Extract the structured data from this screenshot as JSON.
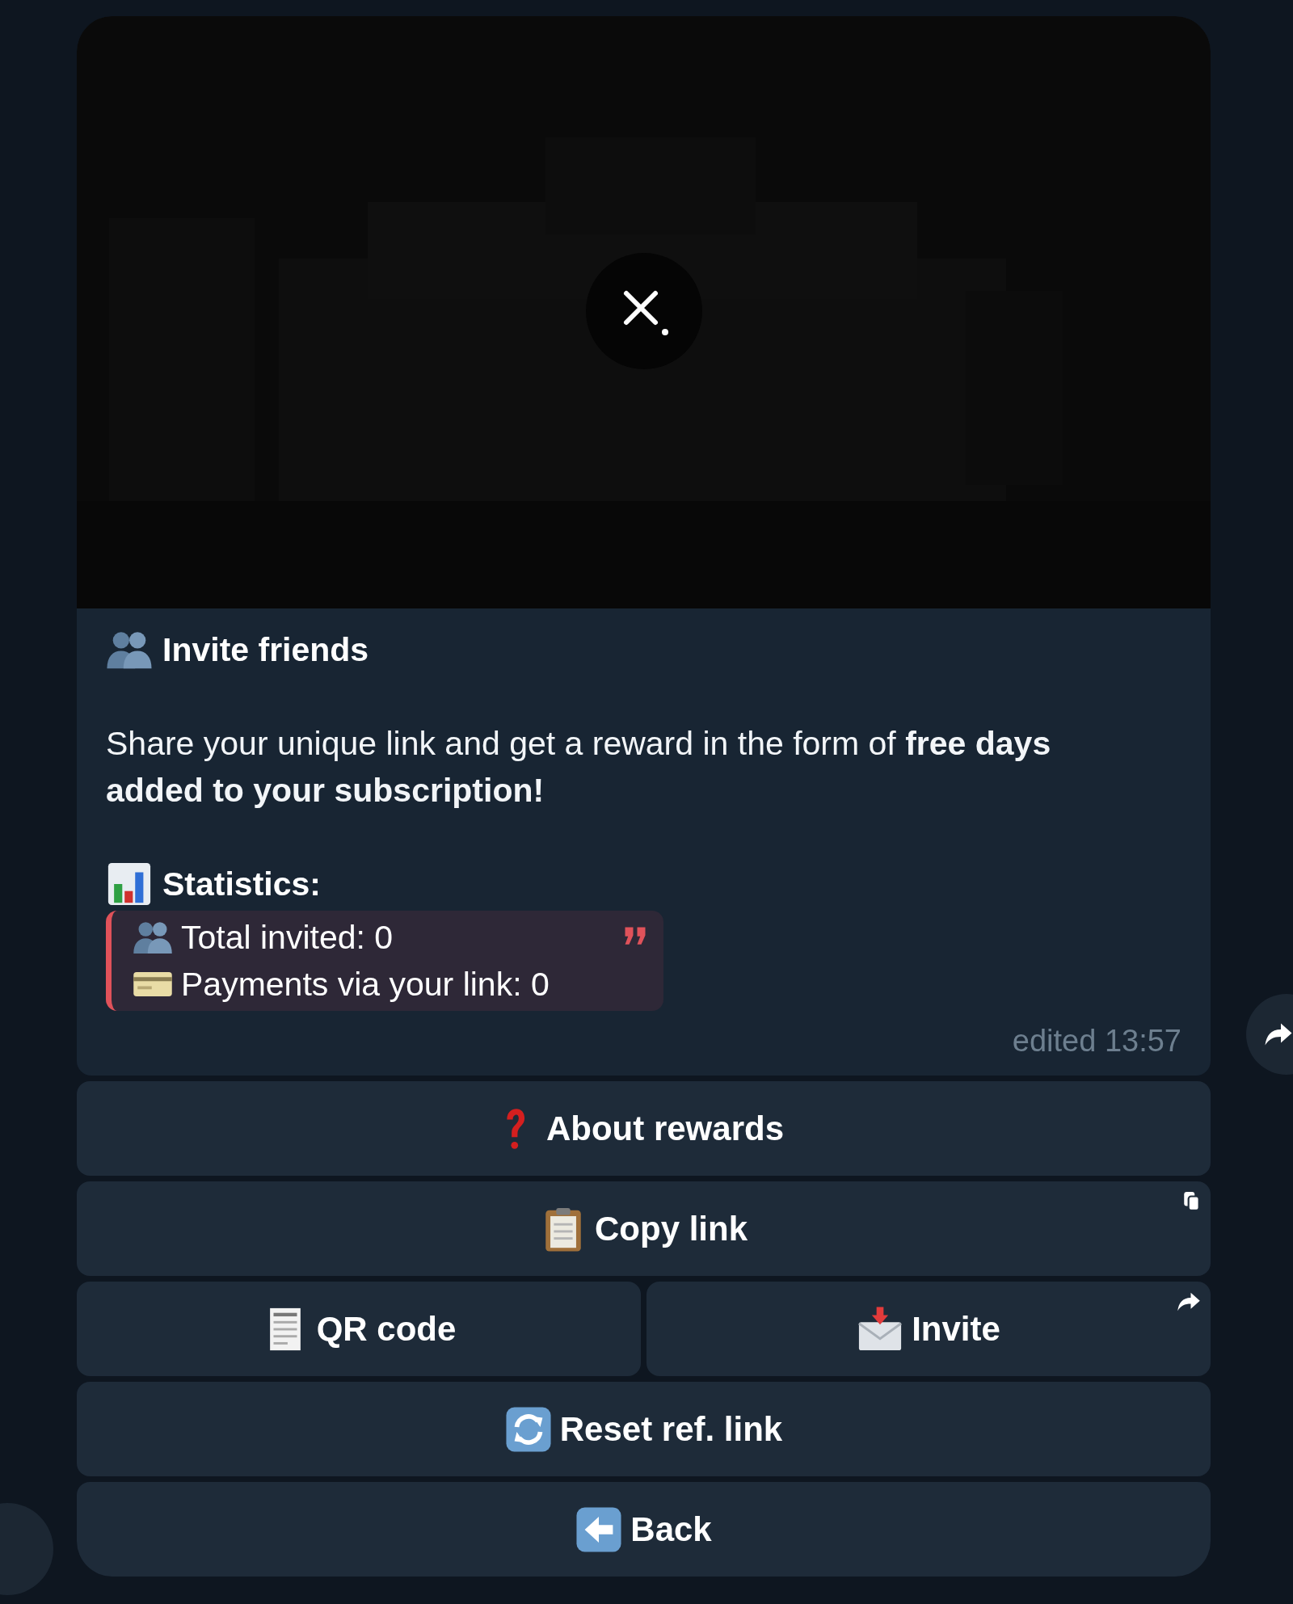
{
  "media": {
    "kind": "picture"
  },
  "message": {
    "title": "Invite friends",
    "body": "Share your unique link and get a reward in the form of **free days added to your subscription!**",
    "stats_title": "Statistics:",
    "quote": [
      "Total invited: 0",
      "Payments via your link: 0"
    ],
    "footer": "edited 13:57"
  },
  "keyboard": [
    [
      "About rewards"
    ],
    [
      "Copy link"
    ],
    [
      "QR code",
      "Invite"
    ],
    [
      "Reset ref. link"
    ],
    [
      "Back"
    ]
  ]
}
